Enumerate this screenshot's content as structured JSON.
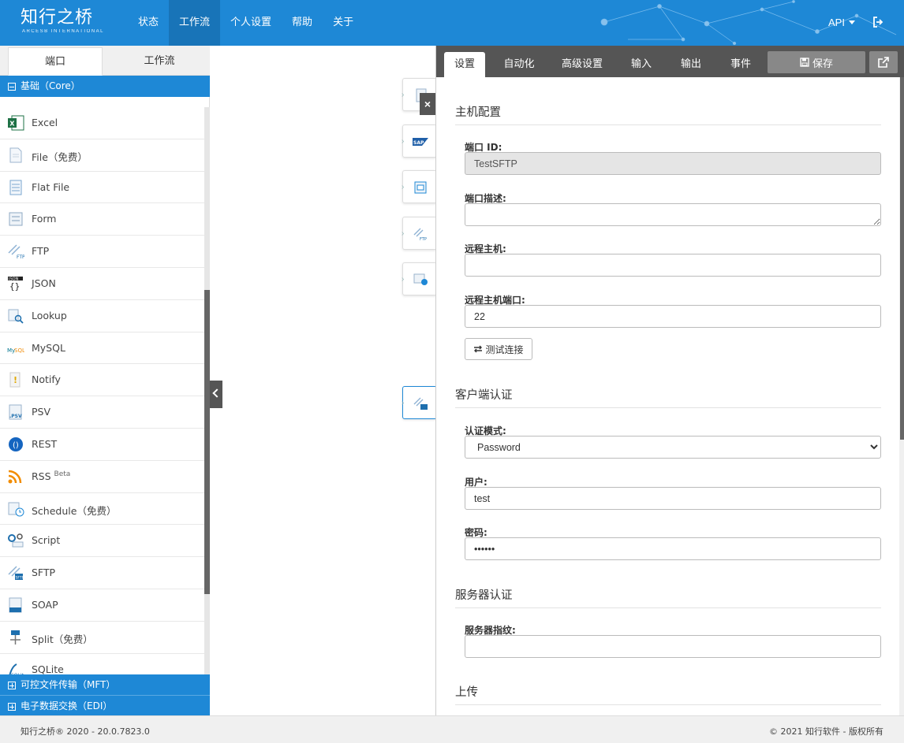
{
  "app": {
    "logo_zh": "知行之桥",
    "logo_en": "ARCESB INTERNATIONAL",
    "nav": [
      "状态",
      "工作流",
      "个人设置",
      "帮助",
      "关于"
    ],
    "nav_active": "工作流",
    "api_label": "API"
  },
  "left": {
    "tabs": [
      "端口",
      "工作流"
    ],
    "active_tab": "端口",
    "group_core": "基础（Core）",
    "group_mft": "可控文件传输（MFT）",
    "group_edi": "电子数据交换（EDI）",
    "items": [
      {
        "label": "Excel",
        "icon": "excel-icon"
      },
      {
        "label": "File（免费）",
        "icon": "file-icon"
      },
      {
        "label": "Flat File",
        "icon": "flat-file-icon"
      },
      {
        "label": "Form",
        "icon": "form-icon"
      },
      {
        "label": "FTP",
        "icon": "ftp-icon"
      },
      {
        "label": "JSON",
        "icon": "json-icon"
      },
      {
        "label": "Lookup",
        "icon": "lookup-icon"
      },
      {
        "label": "MySQL",
        "icon": "mysql-icon"
      },
      {
        "label": "Notify",
        "icon": "notify-icon"
      },
      {
        "label": "PSV",
        "icon": "psv-icon"
      },
      {
        "label": "REST",
        "icon": "rest-icon"
      },
      {
        "label": "RSS",
        "sup": "Beta",
        "icon": "rss-icon"
      },
      {
        "label": "Schedule（免费）",
        "icon": "schedule-icon"
      },
      {
        "label": "Script",
        "icon": "script-icon"
      },
      {
        "label": "SFTP",
        "icon": "sftp-icon"
      },
      {
        "label": "SOAP",
        "icon": "soap-icon"
      },
      {
        "label": "Split（免费）",
        "icon": "split-icon"
      },
      {
        "label": "SQLite",
        "icon": "sqlite-icon"
      }
    ]
  },
  "right": {
    "tabs": [
      "设置",
      "自动化",
      "高级设置",
      "输入",
      "输出",
      "事件"
    ],
    "active_tab": "设置",
    "save_label": "保存",
    "sections": {
      "host": "主机配置",
      "client_auth": "客户端认证",
      "server_auth": "服务器认证",
      "upload": "上传"
    },
    "fields": {
      "port_id_label": "端口 ID:",
      "port_id_value": "TestSFTP",
      "port_desc_label": "端口描述:",
      "port_desc_value": "",
      "remote_host_label": "远程主机:",
      "remote_host_value": "",
      "remote_port_label": "远程主机端口:",
      "remote_port_value": "22",
      "test_btn": "测试连接",
      "auth_mode_label": "认证模式:",
      "auth_mode_value": "Password",
      "user_label": "用户:",
      "user_value": "test",
      "password_label": "密码:",
      "password_value": "••••••",
      "fingerprint_label": "服务器指纹:",
      "fingerprint_value": ""
    }
  },
  "footer": {
    "left": "知行之桥® 2020 - 20.0.7823.0",
    "right": "© 2021 知行软件 - 版权所有"
  },
  "colors": {
    "primary": "#1e88d6",
    "dark": "#555555",
    "nav_active": "#1874b8"
  }
}
